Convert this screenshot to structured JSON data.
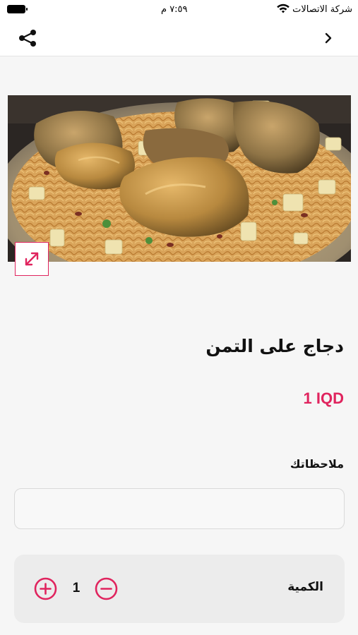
{
  "status_bar": {
    "carrier": "شركة الاتصالات",
    "time": "٧:٥٩ م",
    "wifi_icon": "wifi-icon",
    "battery_icon": "battery-icon"
  },
  "nav": {
    "share_icon": "share-icon",
    "back_icon": "chevron-right-icon"
  },
  "product": {
    "title": "دجاج على التمن",
    "price": "1 IQD",
    "image_alt": "",
    "expand_icon": "expand-icon"
  },
  "notes": {
    "label": "ملاحظاتك",
    "value": "",
    "placeholder": ""
  },
  "quantity": {
    "label": "الكمية",
    "value": "1",
    "plus_icon": "plus-circle-icon",
    "minus_icon": "minus-circle-icon"
  },
  "colors": {
    "accent": "#e0245e",
    "background": "#f6f6f6",
    "card": "#ececec"
  }
}
